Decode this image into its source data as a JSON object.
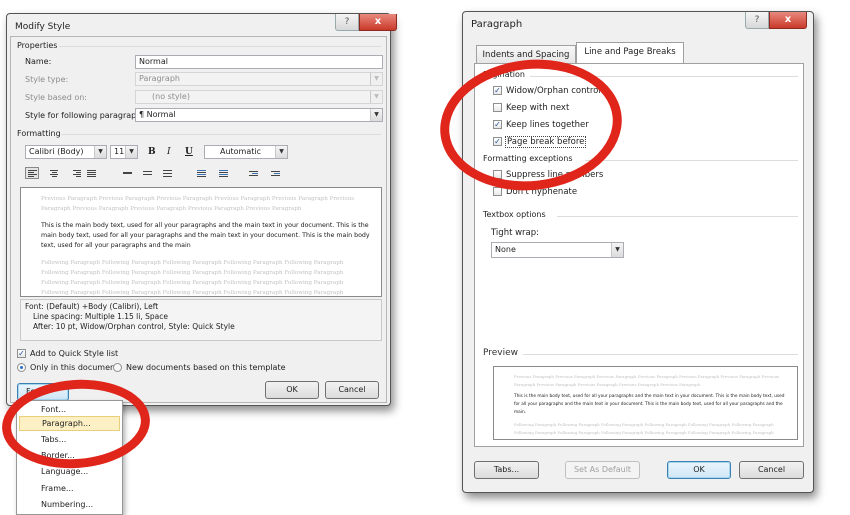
{
  "modify_style": {
    "title": "Modify Style",
    "help_label": "?",
    "close_label": "x",
    "properties": {
      "heading": "Properties",
      "name_label": "Name:",
      "name_value": "Normal",
      "style_type_label": "Style type:",
      "style_type_value": "Paragraph",
      "based_on_label": "Style based on:",
      "based_on_value": "(no style)",
      "following_label": "Style for following paragraph:",
      "following_value": "¶ Normal"
    },
    "formatting": {
      "heading": "Formatting",
      "font": "Calibri (Body)",
      "size": "11",
      "bold": "B",
      "italic": "I",
      "underline": "U",
      "color": "Automatic"
    },
    "preview": {
      "previous": "Previous Paragraph Previous Paragraph Previous Paragraph Previous Paragraph Previous Paragraph Previous Paragraph Previous Paragraph Previous Paragraph Previous Paragraph Previous Paragraph",
      "main": "This is the main body text, used for all your paragraphs and the main text in your document. This is the main body text, used for all your paragraphs and the main text in your document. This is the main body text, used for all your paragraphs and the main",
      "following": "Following Paragraph Following Paragraph Following Paragraph Following Paragraph Following Paragraph Following Paragraph Following Paragraph Following Paragraph Following Paragraph Following Paragraph Following Paragraph Following Paragraph Following Paragraph Following Paragraph Following Paragraph Following Paragraph Following Paragraph Following Paragraph Following Paragraph Following Paragraph"
    },
    "description": {
      "line1": "Font: (Default) +Body (Calibri), Left",
      "line2": "Line spacing:  Multiple 1.15 li, Space",
      "line3": "After:  10 pt, Widow/Orphan control, Style: Quick Style"
    },
    "add_quick_style": {
      "label": "Add to Quick Style list",
      "checked": true
    },
    "radio_only_doc": {
      "label": "Only in this document",
      "selected": true
    },
    "radio_new_docs": {
      "label": "New documents based on this template",
      "selected": false
    },
    "format_button": "Fo",
    "ok_button": "OK",
    "cancel_button": "Cancel"
  },
  "format_menu": {
    "items": [
      {
        "label": "Font...",
        "highlighted": false
      },
      {
        "label": "Paragraph...",
        "highlighted": true
      },
      {
        "label": "Tabs...",
        "highlighted": false
      },
      {
        "label": "Border...",
        "highlighted": false
      },
      {
        "label": "Language...",
        "highlighted": false
      },
      {
        "label": "Frame...",
        "highlighted": false
      },
      {
        "label": "Numbering...",
        "highlighted": false
      }
    ]
  },
  "paragraph": {
    "title": "Paragraph",
    "help_label": "?",
    "close_label": "x",
    "tabs": [
      {
        "label": "Indents and Spacing",
        "active": false
      },
      {
        "label": "Line and Page Breaks",
        "active": true
      }
    ],
    "pagination": {
      "heading": "Pagination",
      "options": [
        {
          "label": "Widow/Orphan control",
          "checked": true
        },
        {
          "label": "Keep with next",
          "checked": false
        },
        {
          "label": "Keep lines together",
          "checked": true
        },
        {
          "label": "Page break before",
          "checked": true
        }
      ]
    },
    "exceptions": {
      "heading": "Formatting exceptions",
      "options": [
        {
          "label": "Suppress line numbers",
          "checked": false
        },
        {
          "label": "Don't hyphenate",
          "checked": false
        }
      ]
    },
    "textbox": {
      "heading": "Textbox options",
      "tight_wrap_label": "Tight wrap:",
      "tight_wrap_value": "None"
    },
    "preview": {
      "heading": "Preview",
      "previous": "Previous Paragraph Previous Paragraph Previous Paragraph Previous Paragraph Previous Paragraph Previous Paragraph Previous Paragraph Previous Paragraph Previous Paragraph Previous Paragraph Previous Paragraph",
      "main": "This is the main body text, used for all your paragraphs and the main text in your document. This is the main body text, used for all your paragraphs and the main text in your document. This is the main body text, used for all your paragraphs and the main.",
      "following": "Following Paragraph Following Paragraph Following Paragraph Following Paragraph Following Paragraph Following Paragraph Following Paragraph Following Paragraph Following Paragraph Following Paragraph Following Paragraph Following Paragraph"
    },
    "tabs_button": "Tabs...",
    "set_default_button": "Set As Default",
    "ok_button": "OK",
    "cancel_button": "Cancel"
  },
  "annotation_color": "#e0251b"
}
